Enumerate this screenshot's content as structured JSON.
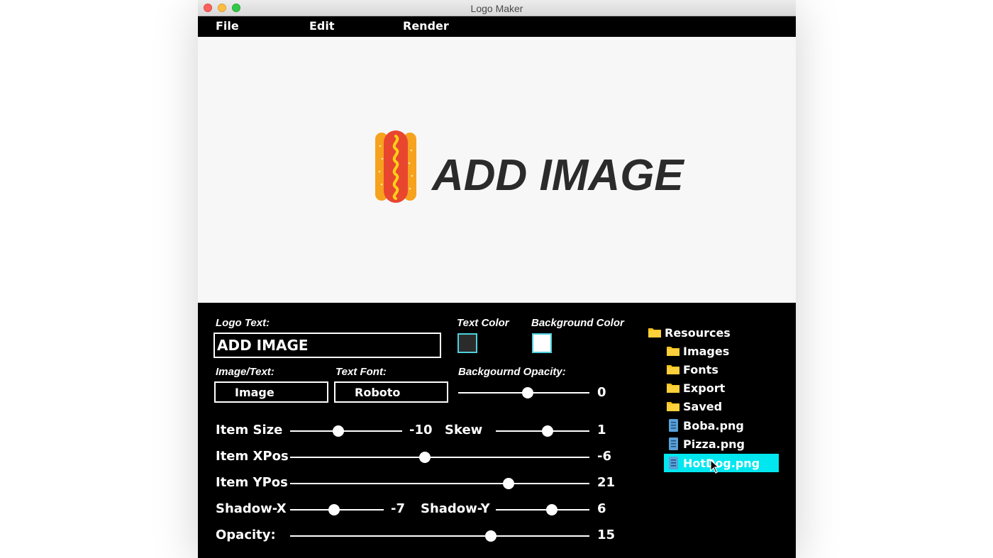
{
  "window": {
    "title": "Logo Maker"
  },
  "menu": {
    "items": [
      "File",
      "Edit",
      "Render"
    ]
  },
  "preview": {
    "text": "ADD IMAGE",
    "image": "hotdog"
  },
  "controls": {
    "logo_text_label": "Logo Text:",
    "logo_text_value": "ADD IMAGE",
    "text_color_label": "Text Color",
    "text_color": "#2b2b2b",
    "background_color_label": "Background Color",
    "background_color": "#ffffff",
    "image_text_label": "Image/Text:",
    "image_text_value": "Image",
    "text_font_label": "Text Font:",
    "text_font_value": "Roboto",
    "bg_opacity_label": "Backgournd Opacity:",
    "bg_opacity_value": "0"
  },
  "sliders": [
    {
      "key": "item_size",
      "label": "Item Size",
      "value": "-10",
      "fraction": 0.43
    },
    {
      "key": "skew",
      "label": "Skew",
      "value": "1",
      "fraction": 0.55
    },
    {
      "key": "item_xpos",
      "label": "Item XPos",
      "value": "-6",
      "fraction": 0.45
    },
    {
      "key": "item_ypos",
      "label": "Item YPos",
      "value": "21",
      "fraction": 0.73
    },
    {
      "key": "shadow_x",
      "label": "Shadow-X",
      "value": "-7",
      "fraction": 0.47
    },
    {
      "key": "shadow_y",
      "label": "Shadow-Y",
      "value": "6",
      "fraction": 0.6
    },
    {
      "key": "opacity",
      "label": "Opacity:",
      "value": "15",
      "fraction": 0.67
    }
  ],
  "bg_opacity_fraction": 0.53,
  "tree": {
    "root": "Resources",
    "folders": [
      "Images",
      "Fonts",
      "Export",
      "Saved"
    ],
    "files": [
      "Boba.png",
      "Pizza.png",
      "HotDog.png"
    ],
    "selected": "HotDog.png"
  },
  "colors": {
    "accent": "#00e7f0",
    "folder": "#f7c21a",
    "file": "#5aa0d8"
  }
}
